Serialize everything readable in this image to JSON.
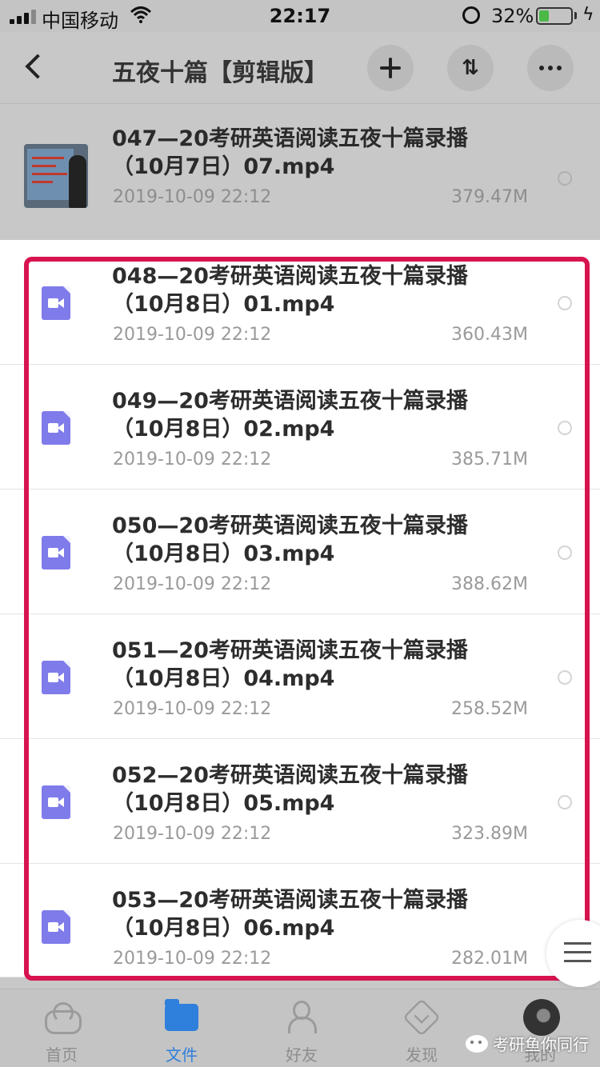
{
  "status_bar": {
    "carrier": "中国移动",
    "time": "22:17",
    "battery": "32%",
    "battery_level": 0.32,
    "charge_symbol": "ϟ"
  },
  "header": {
    "title": "五夜十篇【剪辑版】",
    "sort_symbol": "⇅"
  },
  "files": [
    {
      "name": "047—20考研英语阅读五夜十篇录播（10月7日）07.mp4",
      "date": "2019-10-09 22:12",
      "size": "379.47M"
    },
    {
      "name": "048—20考研英语阅读五夜十篇录播（10月8日）01.mp4",
      "date": "2019-10-09 22:12",
      "size": "360.43M"
    },
    {
      "name": "049—20考研英语阅读五夜十篇录播（10月8日）02.mp4",
      "date": "2019-10-09 22:12",
      "size": "385.71M"
    },
    {
      "name": "050—20考研英语阅读五夜十篇录播（10月8日）03.mp4",
      "date": "2019-10-09 22:12",
      "size": "388.62M"
    },
    {
      "name": "051—20考研英语阅读五夜十篇录播（10月8日）04.mp4",
      "date": "2019-10-09 22:12",
      "size": "258.52M"
    },
    {
      "name": "052—20考研英语阅读五夜十篇录播（10月8日）05.mp4",
      "date": "2019-10-09 22:12",
      "size": "323.89M"
    },
    {
      "name": "053—20考研英语阅读五夜十篇录播（10月8日）06.mp4",
      "date": "2019-10-09 22:12",
      "size": "282.01M"
    }
  ],
  "tabs": [
    {
      "label": "首页",
      "icon": "cloud-icon"
    },
    {
      "label": "文件",
      "icon": "folder-icon",
      "active": true
    },
    {
      "label": "好友",
      "icon": "friends-icon"
    },
    {
      "label": "发现",
      "icon": "discover-icon"
    },
    {
      "label": "我的",
      "icon": "avatar"
    }
  ],
  "watermark": "考研鱼你同行",
  "colors": {
    "highlight_border": "#d7144f",
    "active_tab": "#2f7fdc",
    "video_icon": "#7f7bea"
  }
}
